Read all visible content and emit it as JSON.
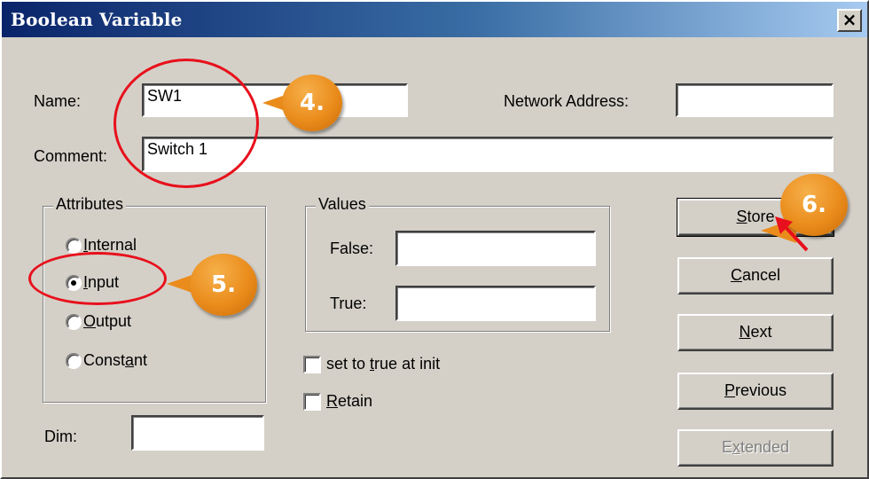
{
  "window": {
    "title": "Boolean Variable",
    "close_glyph": "×"
  },
  "fields": {
    "name_label": "Name:",
    "name_value": "SW1",
    "network_label": "Network Address:",
    "network_value": "",
    "comment_label": "Comment:",
    "comment_value": "Switch 1",
    "dim_label": "Dim:",
    "dim_value": ""
  },
  "attributes": {
    "legend": "Attributes",
    "options": [
      {
        "prefix": "",
        "accel": "I",
        "rest": "nternal",
        "checked": false
      },
      {
        "prefix": "",
        "accel": "I",
        "rest": "nput",
        "checked": true
      },
      {
        "prefix": "",
        "accel": "O",
        "rest": "utput",
        "checked": false
      },
      {
        "prefix": "Const",
        "accel": "a",
        "rest": "nt",
        "checked": false
      }
    ]
  },
  "values": {
    "legend": "Values",
    "false_label": "False:",
    "false_value": "",
    "true_label": "True:",
    "true_value": ""
  },
  "checkboxes": {
    "init": {
      "prefix": "set to ",
      "accel": "t",
      "rest": "rue at init"
    },
    "retain": {
      "prefix": "",
      "accel": "R",
      "rest": "etain"
    }
  },
  "buttons": {
    "store": {
      "accel": "S",
      "rest": "tore"
    },
    "cancel": {
      "accel": "C",
      "rest": "ancel"
    },
    "next": {
      "accel": "N",
      "rest": "ext"
    },
    "previous": {
      "accel": "P",
      "rest": "revious"
    },
    "extended": {
      "prefix": "E",
      "accel": "x",
      "rest": "tended"
    }
  },
  "annotations": {
    "step4": "4.",
    "step5": "5.",
    "step6": "6.",
    "color_ellipse": "#e8101c",
    "color_badge": "#ea8c1c"
  }
}
